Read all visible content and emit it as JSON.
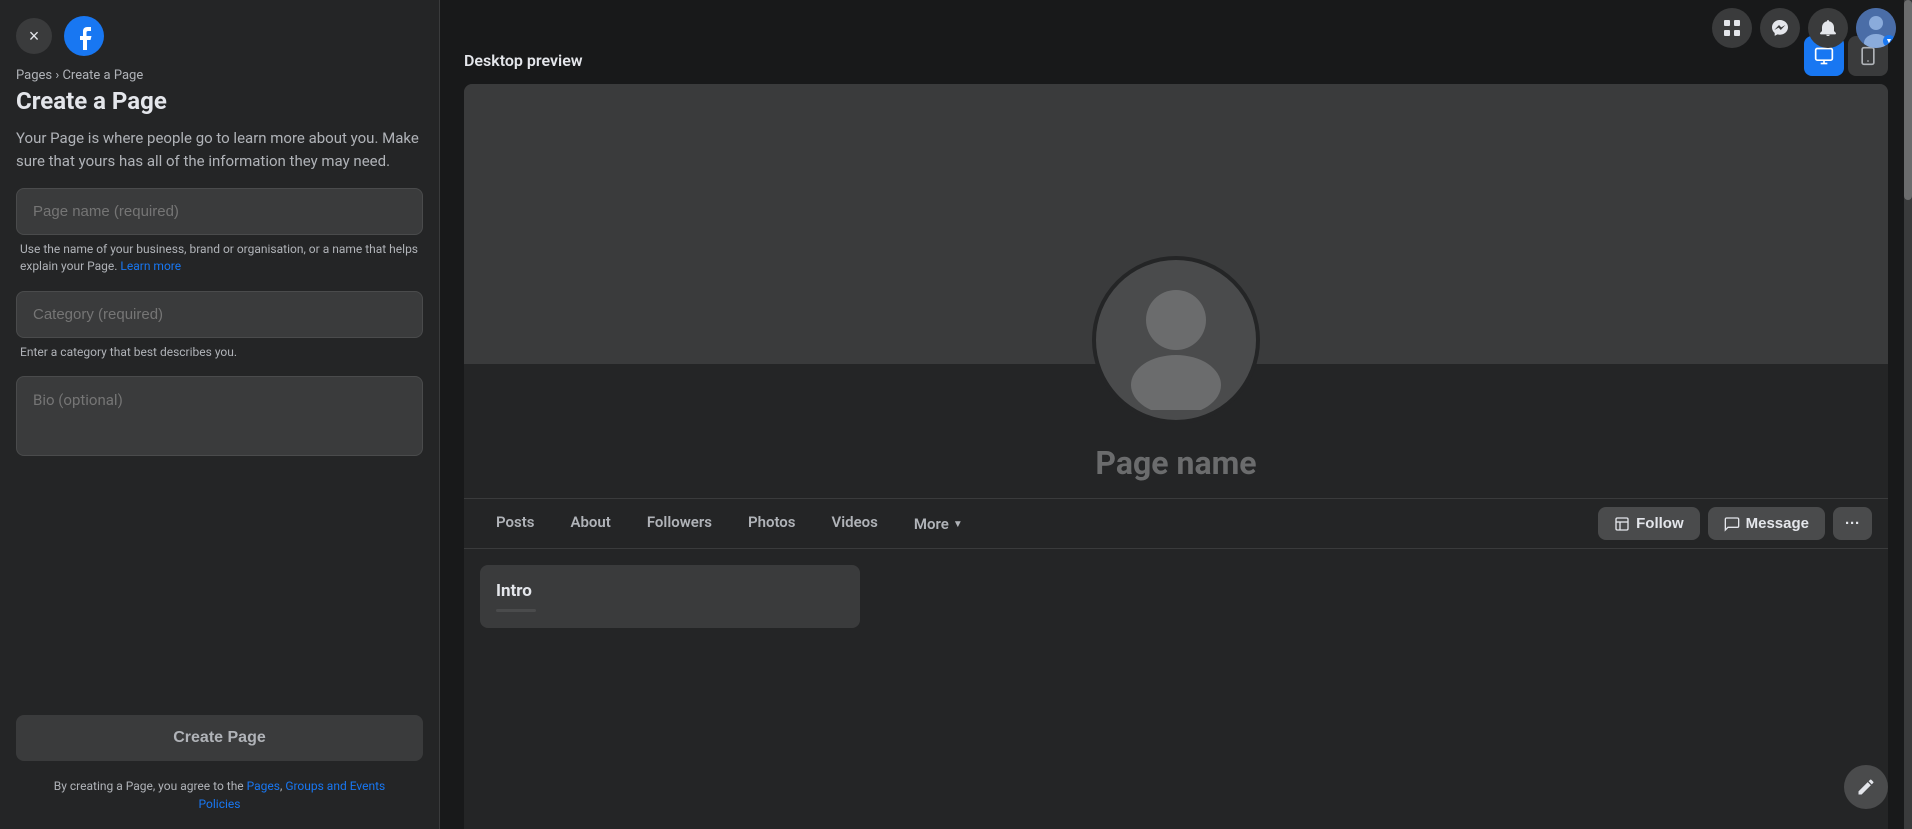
{
  "left": {
    "close_label": "×",
    "breadcrumb": {
      "pages_label": "Pages",
      "separator": " › ",
      "current": "Create a Page"
    },
    "title": "Create a Page",
    "description": "Your Page is where people go to learn more about you. Make sure that yours has all of the information they may need.",
    "form": {
      "page_name_placeholder": "Page name (required)",
      "category_placeholder": "Category (required)",
      "bio_placeholder": "Bio (optional)",
      "page_name_hint": "Use the name of your business, brand or organisation, or a name that helps explain your Page.",
      "learn_more_label": "Learn more",
      "category_hint": "Enter a category that best describes you.",
      "create_page_label": "Create Page"
    },
    "terms": {
      "prefix": "By creating a Page, you agree to the ",
      "pages_label": "Pages",
      "comma": ", ",
      "groups_label": "Groups and Events",
      "policies_label": "Policies",
      "suffix": ""
    }
  },
  "right": {
    "preview_label": "Desktop preview",
    "preview_desktop_icon": "🖥",
    "preview_mobile_icon": "📱",
    "page": {
      "name_placeholder": "Page name",
      "tabs": [
        {
          "label": "Posts",
          "active": false
        },
        {
          "label": "About",
          "active": false
        },
        {
          "label": "Followers",
          "active": false
        },
        {
          "label": "Photos",
          "active": false
        },
        {
          "label": "Videos",
          "active": false
        },
        {
          "label": "More",
          "active": false
        }
      ],
      "actions": {
        "follow_label": "Follow",
        "message_label": "Message",
        "more_label": "···"
      },
      "intro": {
        "title": "Intro"
      }
    }
  },
  "topbar": {
    "grid_icon": "⊞",
    "messenger_icon": "💬",
    "bell_icon": "🔔"
  }
}
